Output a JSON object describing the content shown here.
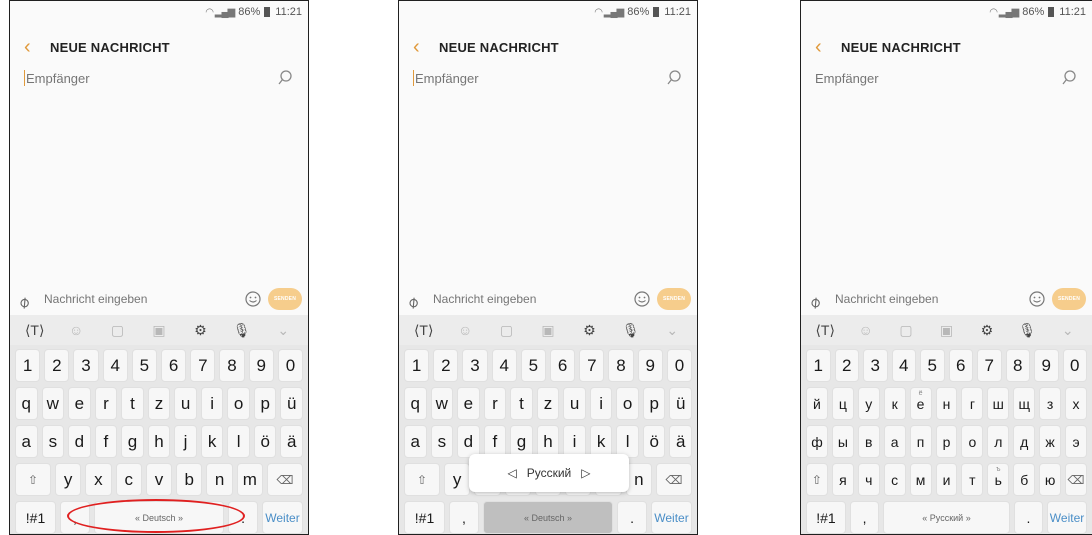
{
  "status": {
    "battery": "86%",
    "time": "11:21"
  },
  "app_bar": {
    "back_icon": "‹",
    "title": "NEUE NACHRICHT"
  },
  "recipient": {
    "placeholder": "Empfänger"
  },
  "message": {
    "placeholder": "Nachricht eingeben",
    "send_label": "SENDEN"
  },
  "toolbar": {
    "icons": [
      "translate-icon",
      "emoji-icon",
      "sticker-icon",
      "gif-icon",
      "settings-icon",
      "mic-icon",
      "collapse-icon"
    ]
  },
  "colors": {
    "accent": "#e09a3c",
    "send_button": "#f6cd8c",
    "enter_key": "#4a8ec7",
    "highlight": "#e02020"
  },
  "keyboard_de": {
    "numbers": [
      "1",
      "2",
      "3",
      "4",
      "5",
      "6",
      "7",
      "8",
      "9",
      "0"
    ],
    "row1": [
      "q",
      "w",
      "e",
      "r",
      "t",
      "z",
      "u",
      "i",
      "o",
      "p",
      "ü"
    ],
    "row2": [
      "a",
      "s",
      "d",
      "f",
      "g",
      "h",
      "j",
      "k",
      "l",
      "ö",
      "ä"
    ],
    "row3": [
      "y",
      "x",
      "c",
      "v",
      "b",
      "n",
      "m"
    ],
    "symbols": "!#1",
    "comma": ",",
    "space": "« Deutsch »",
    "period": ".",
    "enter": "Weiter"
  },
  "keyboard_2_row2_visible": [
    "a",
    "s",
    "d",
    "f",
    "g",
    "h",
    "i",
    "k",
    "l",
    "ö",
    "ä"
  ],
  "keyboard_2_row3_visible": [
    "y",
    "n"
  ],
  "lang_popup": {
    "left_arrow": "◁",
    "label": "Русский",
    "right_arrow": "▷"
  },
  "keyboard_ru": {
    "numbers": [
      "1",
      "2",
      "3",
      "4",
      "5",
      "6",
      "7",
      "8",
      "9",
      "0"
    ],
    "row1": [
      "й",
      "ц",
      "у",
      "к",
      "е",
      "н",
      "г",
      "ш",
      "щ",
      "з",
      "х"
    ],
    "row1_sup": {
      "е": "ё"
    },
    "row2": [
      "ф",
      "ы",
      "в",
      "а",
      "п",
      "р",
      "о",
      "л",
      "д",
      "ж",
      "э"
    ],
    "row3": [
      "я",
      "ч",
      "с",
      "м",
      "и",
      "т",
      "ь",
      "б",
      "ю"
    ],
    "row3_sup": {
      "ь": "ъ"
    },
    "symbols": "!#1",
    "comma": ",",
    "space": "« Русский »",
    "period": ".",
    "enter": "Weiter"
  }
}
